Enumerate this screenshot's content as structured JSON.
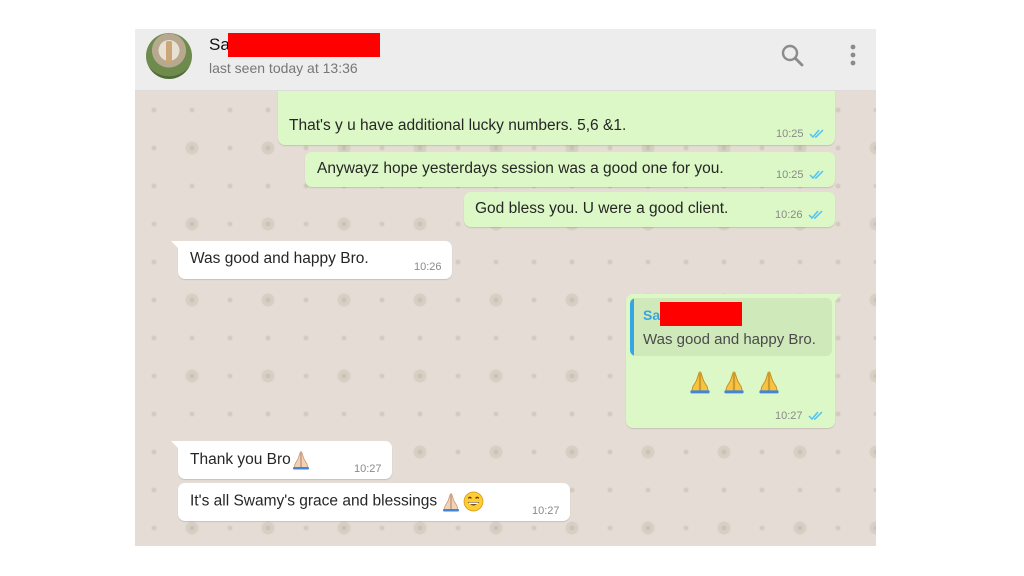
{
  "contact": {
    "name_visible": "Sa",
    "last_seen": "last seen today at 13:36"
  },
  "header_icons": [
    "search-icon",
    "menu-icon"
  ],
  "colors": {
    "outgoing_bubble": "#dcf8c6",
    "incoming_bubble": "#ffffff",
    "chat_background": "#e5ddd5",
    "header_background": "#ededed",
    "read_ticks": "#4fc3f7",
    "redaction": "#ff0000",
    "quote_accent": "#35a7e0"
  },
  "messages": [
    {
      "direction": "out",
      "text": "That's y u have additional lucky numbers. 5,6 &1.",
      "time": "10:25",
      "status": "read"
    },
    {
      "direction": "out",
      "text": "Anywayz hope yesterdays session was a good one for you.",
      "time": "10:25",
      "status": "read"
    },
    {
      "direction": "out",
      "text": "God bless you. U were a good client.",
      "time": "10:26",
      "status": "read"
    },
    {
      "direction": "in",
      "text": "Was good and happy Bro.",
      "time": "10:26"
    },
    {
      "direction": "out",
      "quote_author_visible": "Sa",
      "quote_text": "Was good and happy Bro.",
      "emoji_icons": [
        "folded-hands-icon",
        "folded-hands-icon",
        "folded-hands-icon"
      ],
      "time": "10:27",
      "status": "read"
    },
    {
      "direction": "in",
      "text": "Thank you Bro",
      "emoji_icons": [
        "folded-hands-icon"
      ],
      "time": "10:27"
    },
    {
      "direction": "in",
      "text": "It's all Swamy's grace and blessings ",
      "emoji_icons": [
        "folded-hands-icon",
        "grinning-face-icon"
      ],
      "time": "10:27"
    }
  ]
}
